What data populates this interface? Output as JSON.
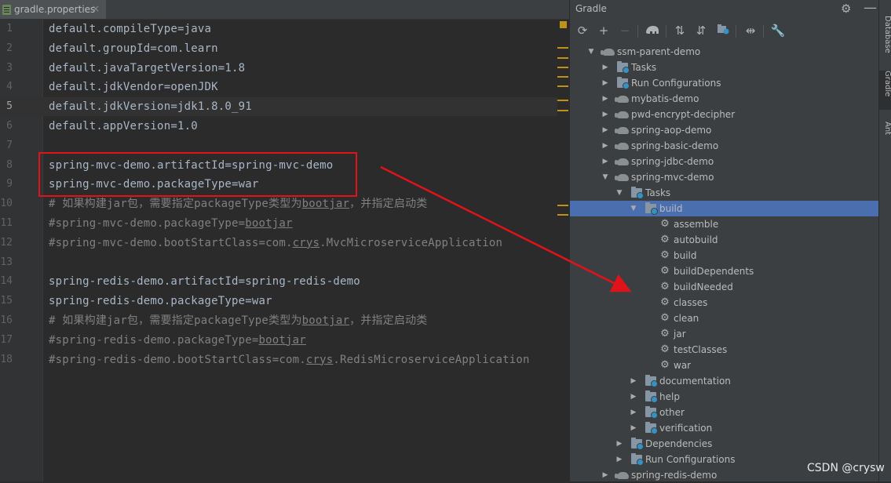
{
  "editor": {
    "tab": {
      "label": "gradle.properties",
      "close": "×"
    },
    "current_line": 5,
    "lines": [
      {
        "n": "1",
        "text": "default.compileType=java"
      },
      {
        "n": "2",
        "text": "default.groupId=com.learn"
      },
      {
        "n": "3",
        "text": "default.javaTargetVersion=1.8"
      },
      {
        "n": "4",
        "text": "default.jdkVendor=openJDK"
      },
      {
        "n": "5",
        "text": "default.jdkVersion=jdk1.8.0_91"
      },
      {
        "n": "6",
        "text": "default.appVersion=1.0"
      },
      {
        "n": "7",
        "text": ""
      },
      {
        "n": "8",
        "text": "spring-mvc-demo.artifactId=spring-mvc-demo"
      },
      {
        "n": "9",
        "text": "spring-mvc-demo.packageType=war"
      },
      {
        "n": "10",
        "text": "# 如果构建jar包，需要指定packageType类型为",
        "u": "bootjar",
        "post": "，并指定启动类"
      },
      {
        "n": "11",
        "text": "#spring-mvc-demo.packageType=",
        "u": "bootjar",
        "post": ""
      },
      {
        "n": "12",
        "text": "#spring-mvc-demo.bootStartClass=com.",
        "u": "crys",
        "post": ".MvcMicroserviceApplication"
      },
      {
        "n": "13",
        "text": ""
      },
      {
        "n": "14",
        "text": "spring-redis-demo.artifactId=spring-redis-demo"
      },
      {
        "n": "15",
        "text": "spring-redis-demo.packageType=war"
      },
      {
        "n": "16",
        "text": "# 如果构建jar包，需要指定packageType类型为",
        "u": "bootjar",
        "post": "，并指定启动类"
      },
      {
        "n": "17",
        "text": "#spring-redis-demo.packageType=",
        "u": "bootjar",
        "post": ""
      },
      {
        "n": "18",
        "text": "#spring-redis-demo.bootStartClass=com.",
        "u": "crys",
        "post": ".RedisMicroserviceApplication"
      }
    ]
  },
  "gradle": {
    "title": "Gradle",
    "toolbar": [
      "refresh-icon",
      "add-icon",
      "remove-icon",
      "execute-task-icon",
      "expand-all-icon",
      "collapse-all-icon",
      "group-modules-icon",
      "toggle-offline-icon",
      "settings-wrench-icon"
    ],
    "tree": [
      {
        "depth": 0,
        "open": true,
        "icon": "elephant",
        "label": "ssm-parent-demo"
      },
      {
        "depth": 1,
        "open": false,
        "icon": "folder",
        "label": "Tasks"
      },
      {
        "depth": 1,
        "open": false,
        "icon": "folder",
        "label": "Run Configurations"
      },
      {
        "depth": 1,
        "open": false,
        "icon": "elephant",
        "label": "mybatis-demo"
      },
      {
        "depth": 1,
        "open": false,
        "icon": "elephant",
        "label": "pwd-encrypt-decipher"
      },
      {
        "depth": 1,
        "open": false,
        "icon": "elephant",
        "label": "spring-aop-demo"
      },
      {
        "depth": 1,
        "open": false,
        "icon": "elephant",
        "label": "spring-basic-demo"
      },
      {
        "depth": 1,
        "open": false,
        "icon": "elephant",
        "label": "spring-jdbc-demo"
      },
      {
        "depth": 1,
        "open": true,
        "icon": "elephant",
        "label": "spring-mvc-demo"
      },
      {
        "depth": 2,
        "open": true,
        "icon": "folder",
        "label": "Tasks"
      },
      {
        "depth": 3,
        "open": true,
        "icon": "folder",
        "label": "build",
        "selected": true
      },
      {
        "depth": 4,
        "icon": "gear",
        "label": "assemble"
      },
      {
        "depth": 4,
        "icon": "gear",
        "label": "autobuild"
      },
      {
        "depth": 4,
        "icon": "gear",
        "label": "build"
      },
      {
        "depth": 4,
        "icon": "gear",
        "label": "buildDependents"
      },
      {
        "depth": 4,
        "icon": "gear",
        "label": "buildNeeded"
      },
      {
        "depth": 4,
        "icon": "gear",
        "label": "classes"
      },
      {
        "depth": 4,
        "icon": "gear",
        "label": "clean"
      },
      {
        "depth": 4,
        "icon": "gear",
        "label": "jar"
      },
      {
        "depth": 4,
        "icon": "gear",
        "label": "testClasses"
      },
      {
        "depth": 4,
        "icon": "gear",
        "label": "war"
      },
      {
        "depth": 3,
        "open": false,
        "icon": "folder",
        "label": "documentation"
      },
      {
        "depth": 3,
        "open": false,
        "icon": "folder",
        "label": "help"
      },
      {
        "depth": 3,
        "open": false,
        "icon": "folder",
        "label": "other"
      },
      {
        "depth": 3,
        "open": false,
        "icon": "folder",
        "label": "verification"
      },
      {
        "depth": 2,
        "open": false,
        "icon": "folder",
        "label": "Dependencies"
      },
      {
        "depth": 2,
        "open": false,
        "icon": "folder",
        "label": "Run Configurations"
      },
      {
        "depth": 1,
        "open": false,
        "icon": "elephant",
        "label": "spring-redis-demo"
      }
    ]
  },
  "side_strip": [
    "Database",
    "Gradle",
    "Ant"
  ],
  "watermark": "CSDN @crysw",
  "colors": {
    "highlight_box": "#e0131b",
    "selection": "#4b6eaf",
    "warning_marker": "#be9117"
  }
}
